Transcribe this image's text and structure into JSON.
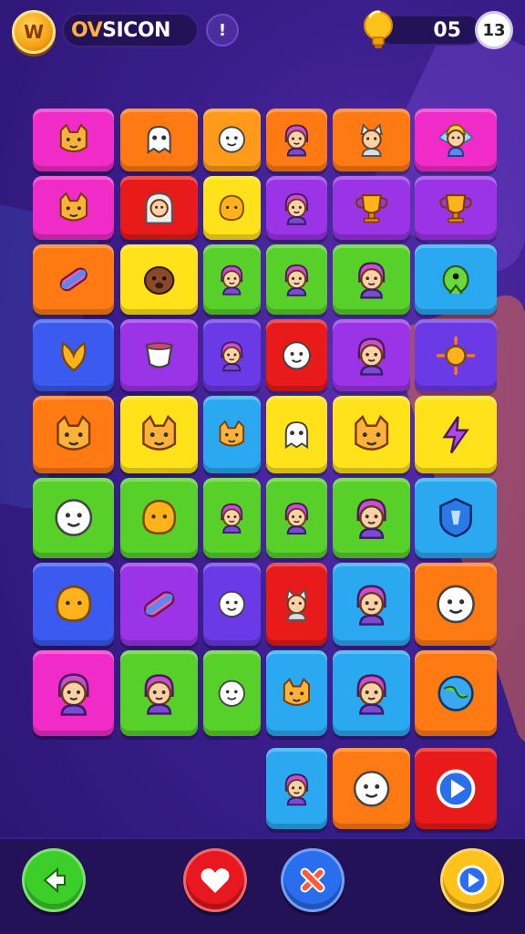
{
  "hud": {
    "coin_label": "W",
    "title_accent": "OV",
    "title_rest": "SICON",
    "info_label": "!",
    "score": "05",
    "moves": "13"
  },
  "colors": {
    "magenta": "#f02bc8",
    "orange": "#ff7a12",
    "amber": "#ff9a1a",
    "yellow": "#ffe21a",
    "green": "#58d02a",
    "purple": "#9a34e6",
    "blue": "#3a5af0",
    "cyan": "#2aa8f0",
    "red": "#e81a1a",
    "violet": "#6a3ae6"
  },
  "grid": {
    "rows": [
      [
        {
          "color": "magenta",
          "icon": "cat-face-icon"
        },
        {
          "color": "orange",
          "icon": "ghost-icon"
        },
        {
          "color": "amber",
          "icon": "round-face-icon"
        },
        {
          "color": "orange",
          "icon": "person-icon"
        },
        {
          "color": "orange",
          "icon": "cat-person-icon"
        },
        {
          "color": "magenta",
          "icon": "fairy-icon"
        }
      ],
      [
        {
          "color": "magenta",
          "icon": "cat-face-icon"
        },
        {
          "color": "red",
          "icon": "hooded-person-icon"
        },
        {
          "color": "yellow",
          "icon": "blob-icon"
        },
        {
          "color": "purple",
          "icon": "person-icon"
        },
        {
          "color": "purple",
          "icon": "trophy-icon"
        },
        {
          "color": "purple",
          "icon": "trophy-icon"
        }
      ],
      [
        {
          "color": "orange",
          "icon": "candy-icon"
        },
        {
          "color": "yellow",
          "icon": "dog-icon"
        },
        {
          "color": "green",
          "icon": "person-icon"
        },
        {
          "color": "green",
          "icon": "person-icon"
        },
        {
          "color": "green",
          "icon": "person-icon"
        },
        {
          "color": "cyan",
          "icon": "alien-icon"
        }
      ],
      [
        {
          "color": "blue",
          "icon": "leaf-icon"
        },
        {
          "color": "purple",
          "icon": "cup-icon"
        },
        {
          "color": "violet",
          "icon": "person-icon"
        },
        {
          "color": "red",
          "icon": "round-face-icon"
        },
        {
          "color": "purple",
          "icon": "person-icon"
        },
        {
          "color": "violet",
          "icon": "sun-icon"
        }
      ],
      [
        {
          "color": "orange",
          "icon": "cat-face-icon"
        },
        {
          "color": "yellow",
          "icon": "cat-face-icon"
        },
        {
          "color": "cyan",
          "icon": "cat-face-icon"
        },
        {
          "color": "yellow",
          "icon": "ghost-icon"
        },
        {
          "color": "yellow",
          "icon": "cat-face-icon"
        },
        {
          "color": "yellow",
          "icon": "bolt-icon"
        }
      ],
      [
        {
          "color": "green",
          "icon": "round-face-icon"
        },
        {
          "color": "green",
          "icon": "blob-icon"
        },
        {
          "color": "green",
          "icon": "person-icon"
        },
        {
          "color": "green",
          "icon": "person-icon"
        },
        {
          "color": "green",
          "icon": "person-icon"
        },
        {
          "color": "cyan",
          "icon": "shield-icon"
        }
      ],
      [
        {
          "color": "blue",
          "icon": "blob-icon"
        },
        {
          "color": "purple",
          "icon": "candy-icon"
        },
        {
          "color": "violet",
          "icon": "round-face-icon"
        },
        {
          "color": "red",
          "icon": "cat-person-icon"
        },
        {
          "color": "cyan",
          "icon": "person-icon"
        },
        {
          "color": "orange",
          "icon": "round-face-icon"
        }
      ],
      [
        {
          "color": "magenta",
          "icon": "person-icon"
        },
        {
          "color": "green",
          "icon": "person-icon"
        },
        {
          "color": "green",
          "icon": "round-face-icon"
        },
        {
          "color": "cyan",
          "icon": "cat-face-icon"
        },
        {
          "color": "cyan",
          "icon": "person-icon"
        },
        {
          "color": "orange",
          "icon": "globe-icon"
        }
      ],
      [
        null,
        null,
        null,
        {
          "color": "cyan",
          "icon": "person-icon"
        },
        {
          "color": "orange",
          "icon": "round-face-icon"
        },
        {
          "color": "red",
          "icon": "play-icon"
        }
      ]
    ]
  },
  "bottom": {
    "buttons": [
      {
        "name": "back-button",
        "icon": "arrow-left-icon",
        "color": "#3ccf2a"
      },
      {
        "name": "lives-button",
        "icon": "heart-icon",
        "color": "#e8181e"
      },
      {
        "name": "shuffle-button",
        "icon": "cross-icon",
        "color": "#2a6ef0"
      },
      {
        "name": "play-button",
        "icon": "play-icon",
        "color": "#ffc21a"
      }
    ]
  }
}
